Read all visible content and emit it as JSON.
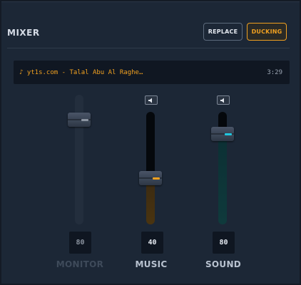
{
  "header": {
    "title": "MIXER"
  },
  "buttons": {
    "replace": "REPLACE",
    "ducking": "DUCKING"
  },
  "track": {
    "name": "♪ yt1s.com - Talal Abu Al Raghe…",
    "time": "3:29"
  },
  "channels": [
    {
      "label": "MONITOR",
      "value": "80",
      "level": 0.8,
      "muted_style": true
    },
    {
      "label": "MUSIC",
      "value": "40",
      "level": 0.4,
      "accent": "#f0a020"
    },
    {
      "label": "SOUND",
      "value": "80",
      "level": 0.8,
      "accent": "#1fc6de"
    }
  ],
  "colors": {
    "accent_orange": "#f0a020",
    "accent_cyan": "#1fc6de"
  },
  "icons": {
    "speaker": "speaker-icon"
  }
}
